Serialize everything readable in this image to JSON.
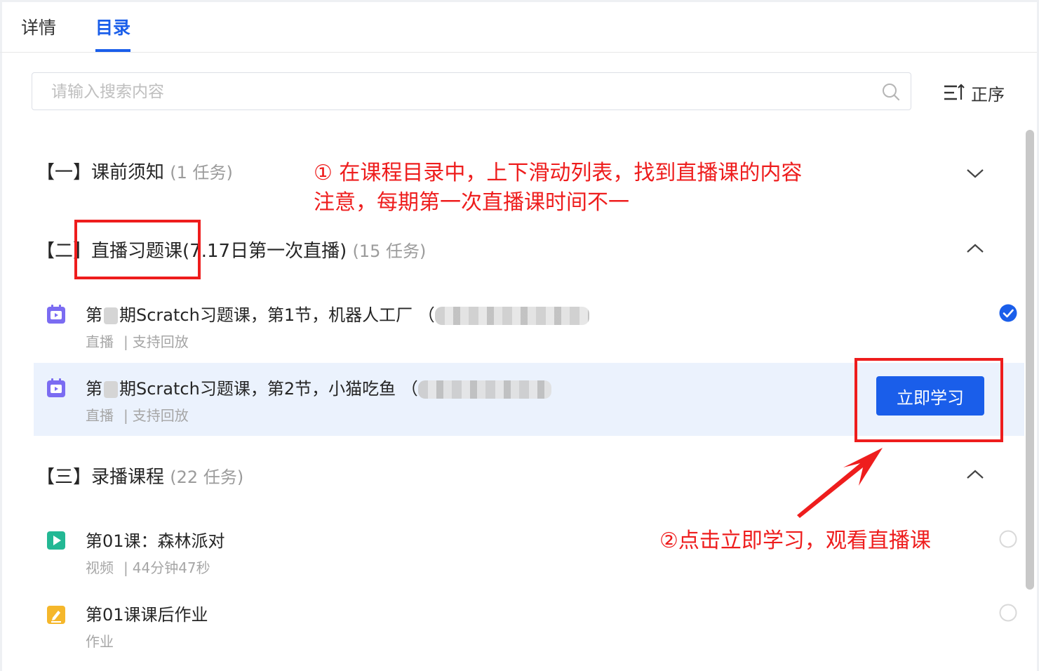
{
  "tabs": {
    "details": "详情",
    "catalog": "目录"
  },
  "search": {
    "placeholder": "请输入搜索内容"
  },
  "sort": {
    "label": "正序"
  },
  "sections": [
    {
      "prefix": "【一】",
      "title": "课前须知",
      "count": "(1 任务)",
      "expanded": false
    },
    {
      "prefix": "【二】",
      "title": "直播习题课",
      "extra": "(7.17日第一次直播)",
      "count": "(15 任务)",
      "expanded": true
    },
    {
      "prefix": "【三】",
      "title": "录播课程",
      "count": "(22 任务)",
      "expanded": true
    }
  ],
  "lessons": [
    {
      "title_a": "第",
      "title_b": "期Scratch习题课，第1节，机器人工厂 （",
      "type": "直播",
      "sep": "|",
      "info": "支持回放",
      "status": "completed",
      "icon": "live-icon"
    },
    {
      "title_a": "第",
      "title_b": "期Scratch习题课，第2节，小猫吃鱼 （",
      "type": "直播",
      "sep": "|",
      "info": "支持回放",
      "status": "current",
      "icon": "live-icon",
      "button": "立即学习"
    },
    {
      "title": "第01课：森林派对",
      "type": "视频",
      "sep": "|",
      "info": "44分钟47秒",
      "status": "not-started",
      "icon": "video-icon"
    },
    {
      "title": "第01课课后作业",
      "type": "作业",
      "status": "not-started",
      "icon": "homework-icon"
    }
  ],
  "annotations": {
    "note1_line1": "① 在课程目录中，上下滑动列表，找到直播课的内容",
    "note1_line2": "注意，每期第一次直播课时间不一",
    "note2": "②点击立即学习，观看直播课",
    "color": "#ee1d1d"
  },
  "colors": {
    "accent": "#1a5eea",
    "highlight_row": "#ebf2fd",
    "muted": "#a6a6a6"
  }
}
